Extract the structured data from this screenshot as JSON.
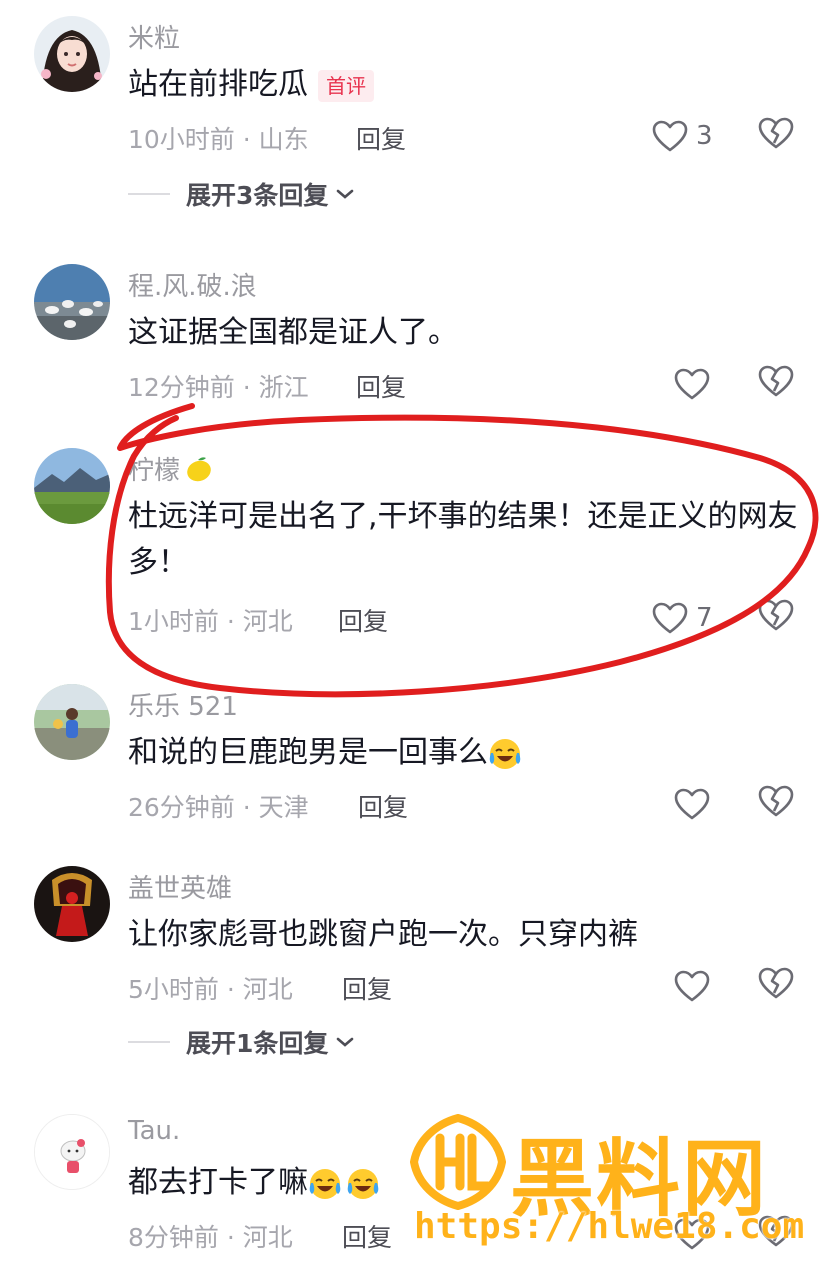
{
  "colors": {
    "text_primary": "#161823",
    "text_secondary": "#9a9aa0",
    "badge_red": "#e8334f",
    "annotation_red": "#e01e1e",
    "watermark_orange": "#ffb21a"
  },
  "comments": [
    {
      "username": "米粒",
      "text": "站在前排吃瓜",
      "badge": "首评",
      "time_location": "10小时前 · 山东",
      "reply_label": "回复",
      "likes": "3",
      "expand": "展开3条回复",
      "avatar_icon": "girl-portrait-avatar"
    },
    {
      "username": "程.风.破.浪",
      "text": "这证据全国都是证人了。",
      "time_location": "12分钟前 · 浙江",
      "reply_label": "回复",
      "likes": "",
      "avatar_icon": "seagulls-avatar"
    },
    {
      "username": "柠檬",
      "username_emoji": "lemon-emoji",
      "text": "杜远洋可是出名了,干坏事的结果！还是正义的网友多！",
      "time_location": "1小时前 · 河北",
      "reply_label": "回复",
      "likes": "7",
      "avatar_icon": "mountain-landscape-avatar"
    },
    {
      "username": "乐乐 521",
      "text": "和说的巨鹿跑男是一回事么",
      "text_emoji": "laughing-crying-emoji",
      "time_location": "26分钟前 · 天津",
      "reply_label": "回复",
      "likes": "",
      "avatar_icon": "child-outdoor-avatar"
    },
    {
      "username": "盖世英雄",
      "text": "让你家彪哥也跳窗户跑一次。只穿内裤",
      "time_location": "5小时前 · 河北",
      "reply_label": "回复",
      "likes": "",
      "expand": "展开1条回复",
      "avatar_icon": "red-bride-avatar"
    },
    {
      "username": "Tau.",
      "text": "都去打卡了嘛",
      "text_emoji": "laughing-crying-emoji x2",
      "time_location": "8分钟前 · 河北",
      "reply_label": "回复",
      "likes": "",
      "avatar_icon": "hello-kitty-avatar"
    }
  ],
  "watermark": {
    "title": "黑料网",
    "url": "https://hlwe18.com"
  }
}
